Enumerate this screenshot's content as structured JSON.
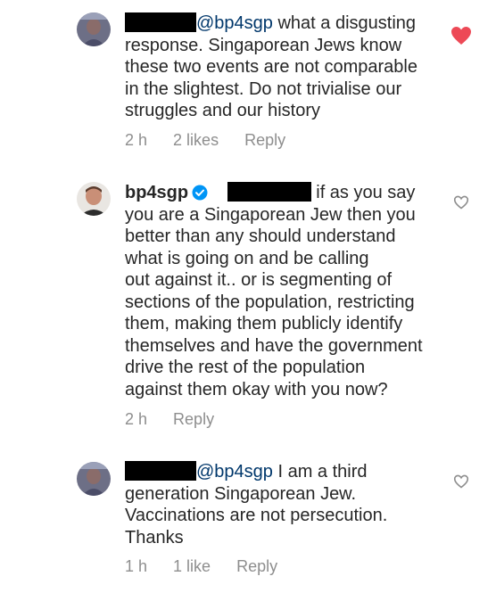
{
  "comments": [
    {
      "mention": "@bp4sgp",
      "text_first": " what a disgusting",
      "lines": [
        "response. Singaporean Jews know",
        "these two events are not comparable",
        "in the slightest. Do not trivialise our",
        "struggles and our history"
      ],
      "time": "2 h",
      "likes": "2 likes",
      "reply": "Reply",
      "liked": true
    },
    {
      "username": "bp4sgp",
      "verified": true,
      "text_first": "if as you say",
      "lines": [
        "you are a Singaporean Jew then you",
        "better than any should understand",
        "what is going on and be calling",
        "out against it.. or is segmenting of",
        "sections of the population, restricting",
        "them, making them publicly identify",
        "themselves and have the government",
        "drive the rest of the population",
        "against them okay with you now?"
      ],
      "time": "2 h",
      "reply": "Reply",
      "liked": false
    },
    {
      "mention": "@bp4sgp",
      "text_first": " I am a third",
      "lines": [
        "generation Singaporean Jew.",
        "Vaccinations are not persecution.",
        "Thanks"
      ],
      "time": "1 h",
      "likes": "1 like",
      "reply": "Reply",
      "liked": false
    }
  ],
  "colors": {
    "text": "#262626",
    "mention": "#00376b",
    "meta": "#8e8e8e",
    "heart_liked": "#ed4956",
    "heart_outline": "#8e8e8e",
    "verified": "#0095f6",
    "redaction": "#000000"
  },
  "icons": [
    "heart-filled-icon",
    "heart-outline-icon",
    "verified-badge-icon",
    "avatar"
  ]
}
